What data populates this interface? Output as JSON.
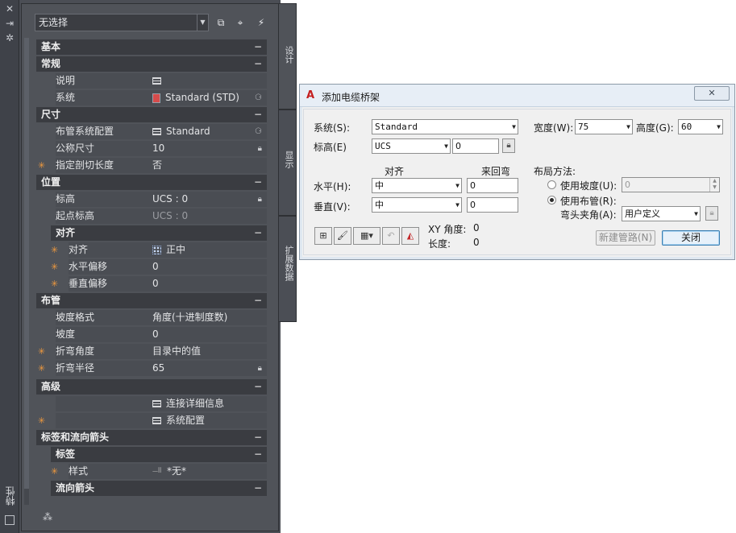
{
  "palette": {
    "title": "特性",
    "titlebar_icons": [
      "close-icon",
      "autohide-icon",
      "settings-icon"
    ],
    "selection": "无选择",
    "quick_buttons": [
      "add-to-selection-icon",
      "pick-object-icon",
      "quick-select-icon"
    ],
    "tabs": [
      "设计",
      "显示",
      "扩展数据"
    ],
    "sections": [
      {
        "title": "基本",
        "toggle": "−"
      },
      {
        "title": "常规",
        "toggle": "−"
      },
      {
        "title": "尺寸",
        "toggle": "−"
      },
      {
        "title": "位置",
        "toggle": "−"
      },
      {
        "title": "对齐",
        "toggle": "−"
      },
      {
        "title": "布管",
        "toggle": "−"
      },
      {
        "title": "高级",
        "toggle": "−"
      },
      {
        "title": "标签和流向箭头",
        "toggle": "−"
      },
      {
        "title": "标签",
        "toggle": "−"
      },
      {
        "title": "流向箭头",
        "toggle": "−"
      }
    ],
    "rows": {
      "description": {
        "name": "说明",
        "value": ""
      },
      "system": {
        "name": "系统",
        "value": "Standard (STD)"
      },
      "routing_pref": {
        "name": "布管系统配置",
        "value": "Standard"
      },
      "nominal_size": {
        "name": "公称尺寸",
        "value": "10"
      },
      "cut_length": {
        "name": "指定剖切长度",
        "value": "否"
      },
      "elevation": {
        "name": "标高",
        "value": "UCS : 0"
      },
      "start_elevation": {
        "name": "起点标高",
        "value": "UCS : 0"
      },
      "justify": {
        "name": "对齐",
        "value": "正中"
      },
      "h_offset": {
        "name": "水平偏移",
        "value": "0"
      },
      "v_offset": {
        "name": "垂直偏移",
        "value": "0"
      },
      "slope_format": {
        "name": "坡度格式",
        "value": "角度(十进制度数)"
      },
      "slope": {
        "name": "坡度",
        "value": "0"
      },
      "bend_angle": {
        "name": "折弯角度",
        "value": "目录中的值"
      },
      "bend_radius": {
        "name": "折弯半径",
        "value": "65"
      },
      "connection_details": {
        "name": "",
        "value": "连接详细信息"
      },
      "system_config": {
        "name": "",
        "value": "系统配置"
      },
      "style": {
        "name": "样式",
        "value": "*无*"
      }
    }
  },
  "dialog": {
    "title": "添加电缆桥架",
    "system_label": "系统(S):",
    "system_value": "Standard",
    "width_label": "宽度(W):",
    "width_value": "75",
    "height_label": "高度(G):",
    "height_value": "60",
    "elevation_label": "标高(E)",
    "elevation_ucs": "UCS",
    "elevation_value": "0",
    "justify_header": "对齐",
    "offset_header": "来回弯",
    "layout_header": "布局方法:",
    "horizontal_label": "水平(H):",
    "horizontal_value": "中",
    "horizontal_offset": "0",
    "vertical_label": "垂直(V):",
    "vertical_value": "中",
    "vertical_offset": "0",
    "use_slope_label": "使用坡度(U):",
    "use_slope_value": "0",
    "use_routing_label": "使用布管(R):",
    "bend_angle_label": "弯头夹角(A):",
    "bend_angle_value": "用户定义",
    "xy_angle_label": "XY 角度:",
    "xy_angle_value": "0",
    "length_label": "长度:",
    "length_value": "0",
    "new_run_button": "新建管路(N)",
    "close_button": "关闭"
  }
}
